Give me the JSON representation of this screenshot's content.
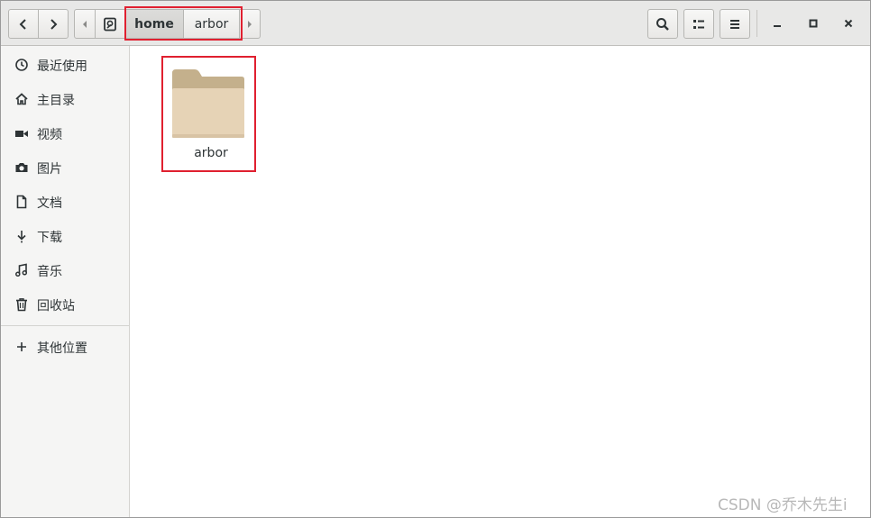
{
  "path_bar": {
    "segments": [
      "home",
      "arbor"
    ]
  },
  "sidebar": {
    "items": [
      {
        "label": "最近使用",
        "icon": "clock-icon"
      },
      {
        "label": "主目录",
        "icon": "home-icon"
      },
      {
        "label": "视频",
        "icon": "video-icon"
      },
      {
        "label": "图片",
        "icon": "camera-icon"
      },
      {
        "label": "文档",
        "icon": "document-icon"
      },
      {
        "label": "下载",
        "icon": "download-icon"
      },
      {
        "label": "音乐",
        "icon": "music-icon"
      },
      {
        "label": "回收站",
        "icon": "trash-icon"
      },
      {
        "label": "其他位置",
        "icon": "plus-icon"
      }
    ]
  },
  "content": {
    "items": [
      {
        "label": "arbor",
        "icon": "folder-icon"
      }
    ]
  },
  "watermark": "CSDN @乔木先生i",
  "colors": {
    "highlight": "#e02030",
    "folder_front": "#e6d3b6",
    "folder_back": "#c4b08c"
  }
}
